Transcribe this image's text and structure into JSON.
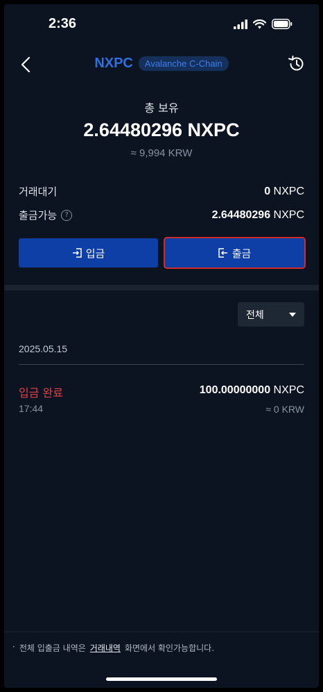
{
  "status_bar": {
    "time": "2:36"
  },
  "header": {
    "title": "NXPC",
    "chain": "Avalanche C-Chain"
  },
  "summary": {
    "total_label": "총 보유",
    "total_amount": "2.64480296 NXPC",
    "total_krw": "≈ 9,994 KRW"
  },
  "balances": {
    "pending_label": "거래대기",
    "pending_value": "0",
    "pending_unit": "NXPC",
    "available_label": "출금가능",
    "available_value": "2.64480296",
    "available_unit": "NXPC"
  },
  "actions": {
    "deposit_label": "입금",
    "withdraw_label": "출금"
  },
  "filter": {
    "selected": "전체"
  },
  "transactions": [
    {
      "date": "2025.05.15",
      "status": "입금 완료",
      "time": "17:44",
      "amount": "100.00000000",
      "unit": "NXPC",
      "krw": "≈ 0 KRW"
    }
  ],
  "footer": {
    "prefix": "전체 입출금 내역은",
    "link": "거래내역",
    "suffix": "화면에서 확인가능합니다."
  },
  "colors": {
    "accent": "#0d3fa6",
    "title": "#2f6fe0",
    "deposit_status": "#e0404a",
    "highlight": "#d42a2a"
  }
}
